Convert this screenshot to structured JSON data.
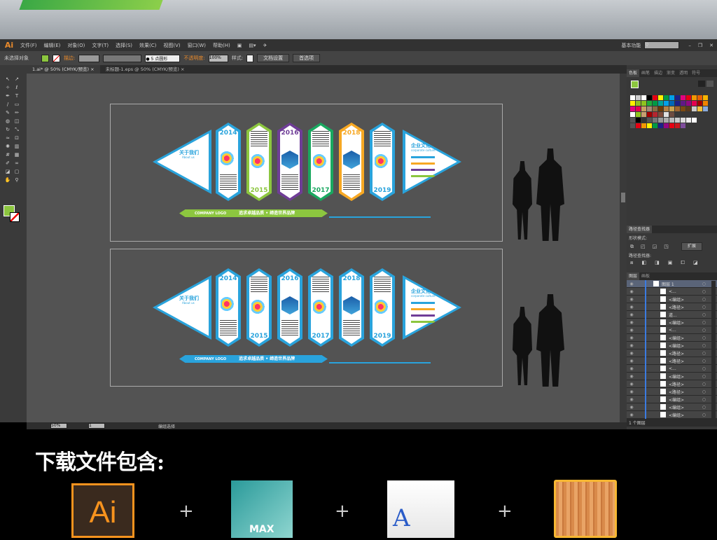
{
  "app": {
    "logo": "Ai"
  },
  "menu": [
    "文件(F)",
    "编辑(E)",
    "对象(O)",
    "文字(T)",
    "选择(S)",
    "效果(C)",
    "视图(V)",
    "窗口(W)",
    "帮助(H)"
  ],
  "workspace": "基本功能",
  "window_controls": {
    "minimize": "–",
    "restore": "❐",
    "close": "✕"
  },
  "control_bar": {
    "selection": "未选择对象",
    "stroke_label": "描边:",
    "brush": "● 5 点圆形",
    "opacity_label": "不透明度:",
    "opacity": "100%",
    "style_label": "样式:",
    "doc_setup": "文档设置",
    "prefs": "首选项"
  },
  "tabs": [
    {
      "label": "1.ai* @ 50% (CMYK/预览)",
      "close": "×"
    },
    {
      "label": "未标题-1.eps @ 50% (CMYK/预览)",
      "close": "×"
    }
  ],
  "status": {
    "zoom": "50%",
    "page": "1",
    "tool": "编组选择"
  },
  "artwork": {
    "left_title": "关于我们",
    "left_sub": "About us",
    "right_title": "企业文化",
    "right_sub": "corporate culture",
    "banner_logo": "COMPANY LOGO",
    "banner_text": "追求卓越品质 • 缔造世界品牌",
    "rows": [
      {
        "colors": [
          "#29a3dc",
          "#8cc63f",
          "#6f3d97",
          "#1aa860",
          "#f7a823",
          "#29a3dc"
        ],
        "banner_color": "#8cc63f"
      },
      {
        "colors": [
          "#29a3dc",
          "#29a3dc",
          "#29a3dc",
          "#29a3dc",
          "#29a3dc",
          "#29a3dc"
        ],
        "banner_color": "#29a3dc"
      }
    ],
    "years": [
      "2014",
      "2015",
      "2016",
      "2017",
      "2018",
      "2019"
    ],
    "accent": "#29a3dc"
  },
  "swatches_panel": {
    "tabs": [
      "色板",
      "画笔",
      "描边",
      "渐变",
      "透明",
      "符号"
    ],
    "rows": [
      [
        "#ffffff",
        "#cccccc",
        "#ffffff",
        "#000000",
        "#e60012",
        "#fff100",
        "#009944",
        "#00a0e9",
        "#1d2088",
        "#e4007f",
        "#e60012",
        "#f39800",
        "#eb6100",
        "#f8b500"
      ],
      [
        "#fff100",
        "#8fc31f",
        "#8fc31f",
        "#22ac38",
        "#009944",
        "#00a29a",
        "#00a0e9",
        "#0068b7",
        "#1d2088",
        "#601986",
        "#920783",
        "#e5004f",
        "#a40000",
        "#f08300"
      ],
      [
        "#e4007f",
        "#e5004f",
        "#c9a063",
        "#a48b78",
        "#8b6c42",
        "#6a3906",
        "#b28146",
        "#c7a252",
        "#a0652e",
        "#7b4a12",
        "#5a3a1c",
        "#ccc",
        "#f0c040",
        "#88aadd"
      ],
      [
        "#ffffff",
        "#8fc31f",
        "#c8a070",
        "#a40000",
        "#b5262f",
        "#7d4b3a",
        "#e0e0e0",
        "#6d4c41"
      ],
      [
        "#555",
        "#000000",
        "#333333",
        "#555555",
        "#777777",
        "#999999",
        "#aaaaaa",
        "#bbbbbb",
        "#cccccc",
        "#dddddd",
        "#eeeeee",
        "#ffffff"
      ],
      [
        "#555",
        "#e60012",
        "#f39800",
        "#fff100",
        "#009944",
        "#1d2088",
        "#920783",
        "#e60012",
        "#c9161d",
        "#7e4d9c"
      ]
    ]
  },
  "pathfinder": {
    "title": "路径查找器",
    "shape_modes": "形状模式:",
    "expand": "扩展",
    "pathfinders": "路径查找器:"
  },
  "layers_panel": {
    "tabs": [
      "图层",
      "画板"
    ],
    "items": [
      "图层 1",
      "<...",
      "<编组>",
      "<路径>",
      "道...",
      "<编组>",
      "<...",
      "<编组>",
      "<编组>",
      "<路径>",
      "<路径>",
      "<...",
      "<编组>",
      "<路径>",
      "<路径>",
      "<编组>",
      "<编组>",
      "<编组>"
    ],
    "footer": "1 个图层"
  },
  "bottom": {
    "heading": "下载文件包含:",
    "files": [
      {
        "label": "Ai",
        "icon": "illustrator-icon"
      },
      {
        "label": "MAX",
        "icon": "3dsmax-icon"
      },
      {
        "label": "A",
        "icon": "font-file-icon"
      },
      {
        "label": "",
        "icon": "wood-texture-icon"
      }
    ],
    "plus": "+"
  }
}
